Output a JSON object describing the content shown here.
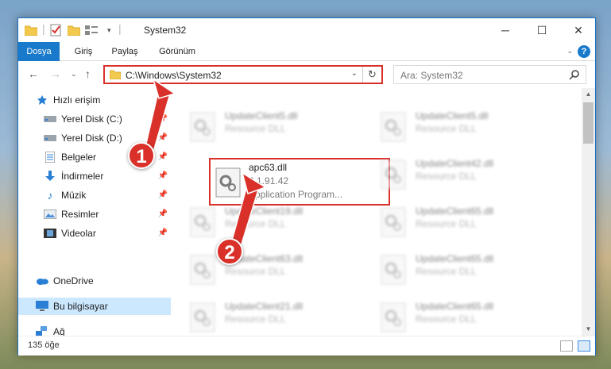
{
  "window": {
    "title": "System32",
    "controls": {
      "minimize": "─",
      "maximize": "☐",
      "close": "✕"
    }
  },
  "ribbon": {
    "tabs": [
      {
        "label": "Dosya"
      },
      {
        "label": "Giriş"
      },
      {
        "label": "Paylaş"
      },
      {
        "label": "Görünüm"
      }
    ],
    "help": "?"
  },
  "address": {
    "path": "C:\\Windows\\System32",
    "search_placeholder": "Ara: System32"
  },
  "nav": {
    "items": [
      {
        "label": "Hızlı erişim",
        "icon": "star-icon"
      },
      {
        "label": "Yerel Disk (C:)",
        "icon": "drive-icon",
        "pinned": true
      },
      {
        "label": "Yerel Disk (D:)",
        "icon": "drive-icon",
        "pinned": true
      },
      {
        "label": "Belgeler",
        "icon": "documents-icon",
        "pinned": true
      },
      {
        "label": "İndirmeler",
        "icon": "download-icon",
        "pinned": true
      },
      {
        "label": "Müzik",
        "icon": "music-icon",
        "pinned": true
      },
      {
        "label": "Resimler",
        "icon": "pictures-icon",
        "pinned": true
      },
      {
        "label": "Videolar",
        "icon": "videos-icon",
        "pinned": true
      },
      {
        "label": "OneDrive",
        "icon": "cloud-icon"
      },
      {
        "label": "Bu bilgisayar",
        "icon": "computer-icon",
        "selected": true
      },
      {
        "label": "Ağ",
        "icon": "network-icon"
      }
    ]
  },
  "files": {
    "left": [
      {
        "name": "UpdateClient5.dll",
        "type": "Resource DLL"
      },
      {
        "name": "apc63.dll",
        "version": "6.1.91.42",
        "type": "Application Program..."
      },
      {
        "name": "UpdateClient19.dll",
        "type": "Resource DLL"
      },
      {
        "name": "UpdateClient63.dll",
        "type": "Resource DLL"
      },
      {
        "name": "UpdateClient21.dll",
        "type": "Resource DLL"
      }
    ],
    "right": [
      {
        "name": "UpdateClient5.dll",
        "type": "Resource DLL"
      },
      {
        "name": "UpdateClient42.dll",
        "type": "Resource DLL"
      },
      {
        "name": "UpdateClient65.dll",
        "type": "Resource DLL"
      },
      {
        "name": "UpdateClient65.dll",
        "type": "Resource DLL"
      },
      {
        "name": "UpdateClient65.dll",
        "type": "Resource DLL"
      }
    ]
  },
  "status": {
    "count": "135 öğe"
  },
  "callouts": [
    "1",
    "2"
  ],
  "colors": {
    "accent": "#1979ca",
    "highlight": "#d9312a",
    "selected": "#cce8ff"
  }
}
